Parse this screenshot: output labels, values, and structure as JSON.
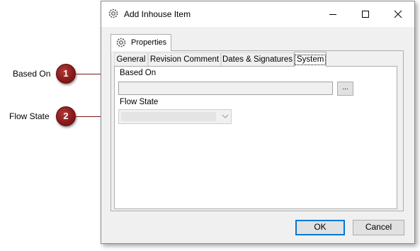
{
  "window": {
    "title": "Add Inhouse Item",
    "icon": "gear-icon",
    "controls": {
      "minimize": "minimize-icon",
      "maximize": "maximize-icon",
      "close": "close-icon"
    }
  },
  "outer_tab": {
    "label": "Properties",
    "icon": "gear-icon"
  },
  "inner_tabs": [
    {
      "label": "General",
      "active": false
    },
    {
      "label": "Revision Comment",
      "active": false
    },
    {
      "label": "Dates & Signatures",
      "active": false
    },
    {
      "label": "System",
      "active": true
    }
  ],
  "fields": {
    "based_on": {
      "label": "Based On",
      "value": "",
      "browse_label": "..."
    },
    "flow_state": {
      "label": "Flow State",
      "selected": ""
    }
  },
  "buttons": {
    "ok": "OK",
    "cancel": "Cancel"
  },
  "callouts": [
    {
      "number": "1",
      "label": "Based On"
    },
    {
      "number": "2",
      "label": "Flow State"
    }
  ],
  "colors": {
    "callout_badge": "#8b1a1a",
    "default_button_border": "#0078d7"
  }
}
